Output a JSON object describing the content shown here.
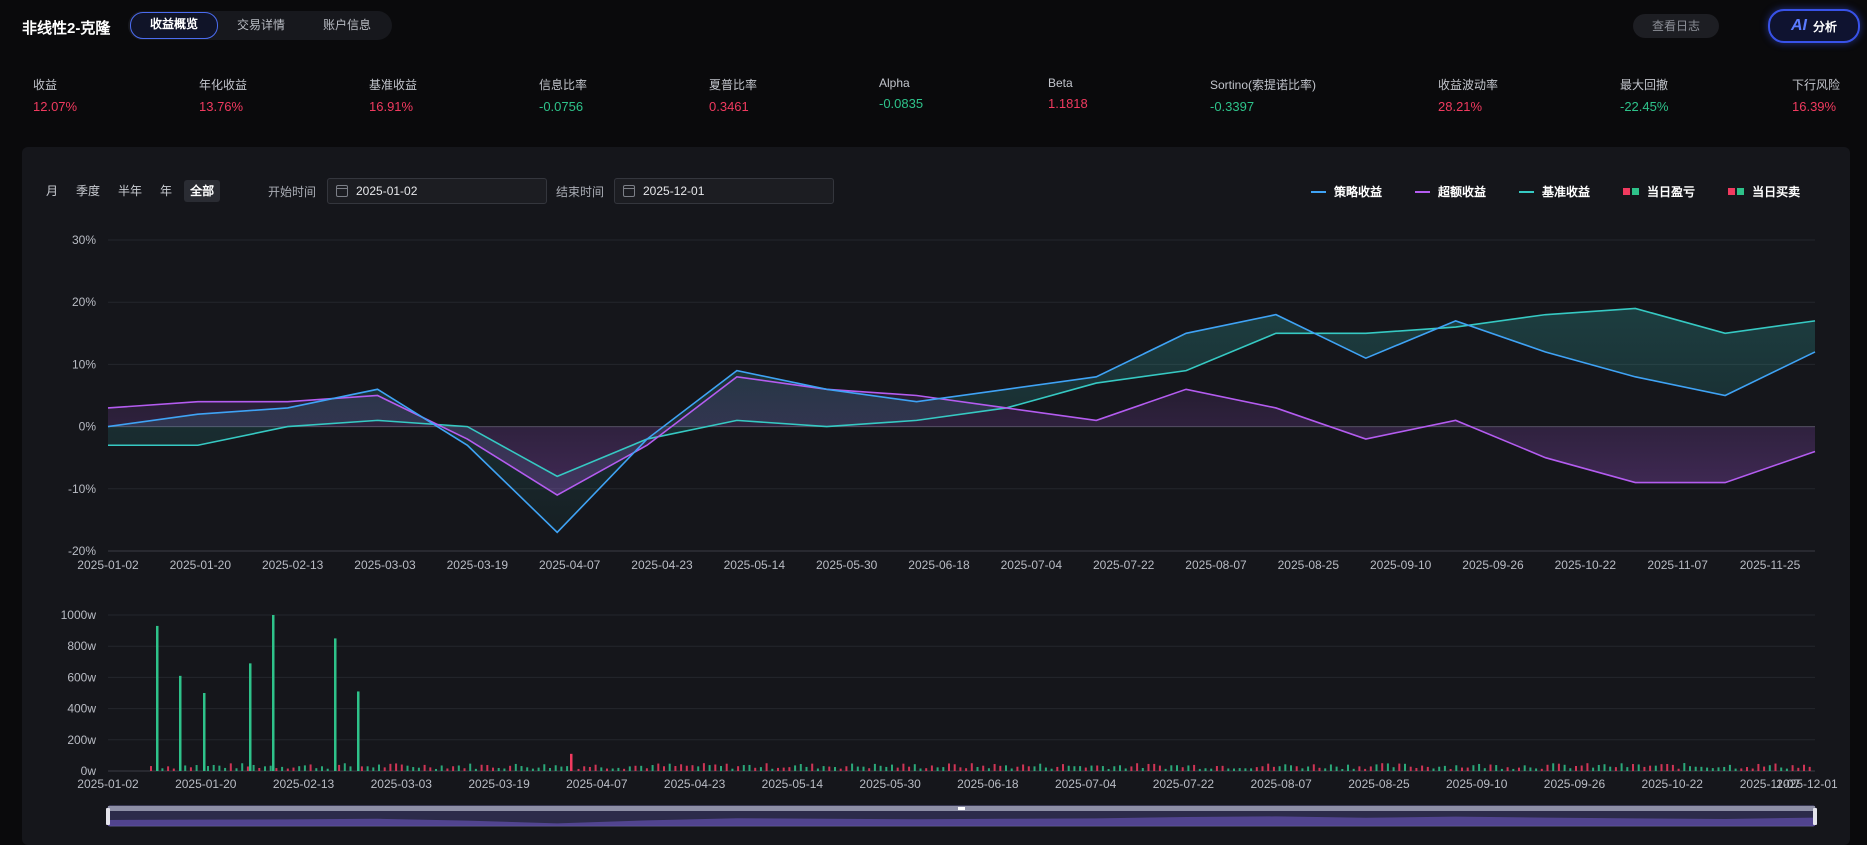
{
  "app": {
    "title": "非线性2-克隆"
  },
  "tabs": [
    {
      "label": "收益概览",
      "active": true
    },
    {
      "label": "交易详情",
      "active": false
    },
    {
      "label": "账户信息",
      "active": false
    }
  ],
  "header": {
    "log_label": "查看日志",
    "ai_logo": "AI",
    "ai_label": "分析"
  },
  "metrics": [
    {
      "label": "收益",
      "value": "12.07%",
      "tone": "red"
    },
    {
      "label": "年化收益",
      "value": "13.76%",
      "tone": "red"
    },
    {
      "label": "基准收益",
      "value": "16.91%",
      "tone": "red"
    },
    {
      "label": "信息比率",
      "value": "-0.0756",
      "tone": "green"
    },
    {
      "label": "夏普比率",
      "value": "0.3461",
      "tone": "red"
    },
    {
      "label": "Alpha",
      "value": "-0.0835",
      "tone": "green"
    },
    {
      "label": "Beta",
      "value": "1.1818",
      "tone": "red"
    },
    {
      "label": "Sortino(索提诺比率)",
      "value": "-0.3397",
      "tone": "green"
    },
    {
      "label": "收益波动率",
      "value": "28.21%",
      "tone": "red"
    },
    {
      "label": "最大回撤",
      "value": "-22.45%",
      "tone": "green"
    },
    {
      "label": "下行风险",
      "value": "16.39%",
      "tone": "red"
    }
  ],
  "controls": {
    "periods": [
      {
        "label": "月",
        "active": false
      },
      {
        "label": "季度",
        "active": false
      },
      {
        "label": "半年",
        "active": false
      },
      {
        "label": "年",
        "active": false
      },
      {
        "label": "全部",
        "active": true
      }
    ],
    "start_label": "开始时间",
    "start_value": "2025-01-02",
    "end_label": "结束时间",
    "end_value": "2025-12-01"
  },
  "legend": [
    {
      "label": "策略收益",
      "kind": "line",
      "color": "#3fa3f5"
    },
    {
      "label": "超额收益",
      "kind": "line",
      "color": "#b45cf0"
    },
    {
      "label": "基准收益",
      "kind": "line",
      "color": "#36c9c3"
    },
    {
      "label": "当日盈亏",
      "kind": "squares",
      "colors": [
        "#f03a5f",
        "#2ec28a"
      ]
    },
    {
      "label": "当日买卖",
      "kind": "squares",
      "colors": [
        "#f03a5f",
        "#2ec28a"
      ]
    }
  ],
  "colors": {
    "strategy": "#3fa3f5",
    "excess": "#b45cf0",
    "benchmark": "#36c9c3",
    "positive": "#f03a5f",
    "negative": "#2ec28a"
  },
  "chart_data": [
    {
      "type": "line",
      "ylim": [
        -20,
        30
      ],
      "y_ticks": [
        "30%",
        "20%",
        "10%",
        "0%",
        "-10%",
        "-20%"
      ],
      "x_tick_labels": [
        "2025-01-02",
        "2025-01-20",
        "2025-02-13",
        "2025-03-03",
        "2025-03-19",
        "2025-04-07",
        "2025-04-23",
        "2025-05-14",
        "2025-05-30",
        "2025-06-18",
        "2025-07-04",
        "2025-07-22",
        "2025-08-07",
        "2025-08-25",
        "2025-09-10",
        "2025-09-26",
        "2025-10-22",
        "2025-11-07",
        "2025-11-25"
      ],
      "x": [
        "2025-01-02",
        "2025-01-20",
        "2025-02-13",
        "2025-03-03",
        "2025-03-19",
        "2025-04-07",
        "2025-04-23",
        "2025-05-14",
        "2025-05-30",
        "2025-06-18",
        "2025-07-04",
        "2025-07-22",
        "2025-08-07",
        "2025-08-25",
        "2025-09-10",
        "2025-09-26",
        "2025-10-22",
        "2025-11-07",
        "2025-11-25",
        "2025-12-01"
      ],
      "series": [
        {
          "name": "策略收益",
          "values": [
            0,
            2,
            3,
            6,
            -3,
            -17,
            -2,
            9,
            6,
            4,
            6,
            8,
            15,
            18,
            11,
            17,
            12,
            8,
            5,
            12
          ]
        },
        {
          "name": "超额收益",
          "values": [
            3,
            4,
            4,
            5,
            -2,
            -11,
            -3,
            8,
            6,
            5,
            3,
            1,
            6,
            3,
            -2,
            1,
            -5,
            -9,
            -9,
            -4
          ]
        },
        {
          "name": "基准收益",
          "values": [
            -3,
            -3,
            0,
            1,
            0,
            -8,
            -2,
            1,
            0,
            1,
            3,
            7,
            9,
            15,
            15,
            16,
            18,
            19,
            15,
            17
          ]
        }
      ]
    },
    {
      "type": "bar",
      "ylim": [
        0,
        1000
      ],
      "y_ticks": [
        "1000w",
        "800w",
        "600w",
        "400w",
        "200w",
        "0w"
      ],
      "x_tick_labels": [
        "2025-01-02",
        "2025-01-20",
        "2025-02-13",
        "2025-03-03",
        "2025-03-19",
        "2025-04-07",
        "2025-04-23",
        "2025-05-14",
        "2025-05-30",
        "2025-06-18",
        "2025-07-04",
        "2025-07-22",
        "2025-08-07",
        "2025-08-25",
        "2025-09-10",
        "2025-09-26",
        "2025-10-22",
        "2025-11-07",
        "2025-12-01"
      ],
      "series": [
        {
          "values": [
            930,
            610,
            500,
            690,
            1000,
            850,
            510,
            110
          ]
        }
      ]
    }
  ]
}
